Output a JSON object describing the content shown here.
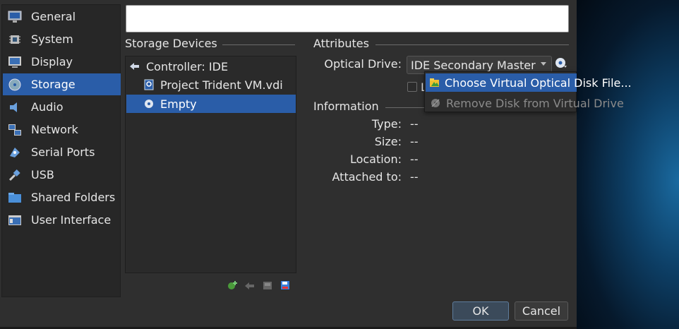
{
  "nav": {
    "items": [
      {
        "label": "General",
        "icon": "monitor-icon"
      },
      {
        "label": "System",
        "icon": "chip-icon"
      },
      {
        "label": "Display",
        "icon": "display-icon"
      },
      {
        "label": "Storage",
        "icon": "disk-icon"
      },
      {
        "label": "Audio",
        "icon": "speaker-icon"
      },
      {
        "label": "Network",
        "icon": "network-icon"
      },
      {
        "label": "Serial Ports",
        "icon": "serial-icon"
      },
      {
        "label": "USB",
        "icon": "usb-icon"
      },
      {
        "label": "Shared Folders",
        "icon": "folder-icon"
      },
      {
        "label": "User Interface",
        "icon": "window-icon"
      }
    ],
    "selected": "Storage"
  },
  "name_field": {
    "value": ""
  },
  "storage": {
    "title": "Storage Devices",
    "tree": [
      {
        "label": "Controller: IDE",
        "icon": "ide-controller-icon"
      },
      {
        "label": "Project Trident VM.vdi",
        "icon": "hard-disk-icon"
      },
      {
        "label": "Empty",
        "icon": "optical-disc-icon"
      }
    ],
    "selected": "Empty"
  },
  "attributes": {
    "title": "Attributes",
    "optical_drive_label": "Optical Drive:",
    "optical_drive_value": "IDE Secondary Master",
    "live_cd_partial": "L"
  },
  "information": {
    "title": "Information",
    "rows": [
      {
        "label": "Type:",
        "value": "--"
      },
      {
        "label": "Size:",
        "value": "--"
      },
      {
        "label": "Location:",
        "value": "--"
      },
      {
        "label": "Attached to:",
        "value": "--"
      }
    ]
  },
  "menu": {
    "items": [
      {
        "label": "Choose Virtual Optical Disk File...",
        "state": "active",
        "icon": "open-folder-icon"
      },
      {
        "label": "Remove Disk from Virtual Drive",
        "state": "disabled",
        "icon": "eject-disc-icon"
      }
    ]
  },
  "buttons": {
    "ok": "OK",
    "cancel": "Cancel"
  },
  "colors": {
    "selection": "#2a5da8",
    "background": "#2f2f2f"
  }
}
